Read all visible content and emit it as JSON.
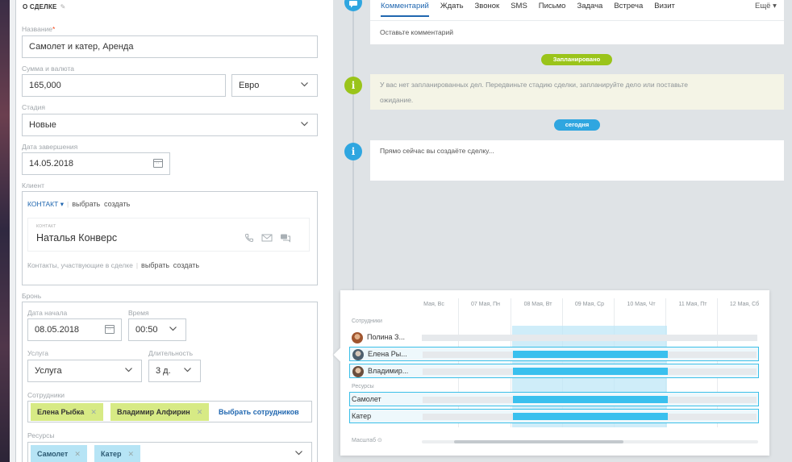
{
  "form": {
    "section_title": "О СДЕЛКЕ",
    "title_label": "Название",
    "title_value": "Самолет и катер, Аренда",
    "amount_label": "Сумма и валюта",
    "amount_value": "165,000",
    "currency_value": "Евро",
    "stage_label": "Стадия",
    "stage_value": "Новые",
    "close_date_label": "Дата завершения",
    "close_date_value": "14.05.2018",
    "client_label": "Клиент",
    "contact_dropdown": "КОНТАКТ",
    "choose": "выбрать",
    "create": "создать",
    "contact_tiny": "КОНТАКТ",
    "contact_name": "Наталья Конверс",
    "participants_label": "Контакты, участвующие в сделке",
    "booking_label": "Бронь",
    "start_date_label": "Дата начала",
    "start_date_value": "08.05.2018",
    "time_label": "Время",
    "time_value": "00:50",
    "service_label": "Услуга",
    "service_value": "Услуга",
    "duration_label": "Длительность",
    "duration_value": "3 д.",
    "employees_label": "Сотрудники",
    "employees": [
      "Елена Рыбка",
      "Владимир Алфирин"
    ],
    "select_employees": "Выбрать сотрудников",
    "resources_label": "Ресурсы",
    "resources": [
      "Самолет",
      "Катер"
    ]
  },
  "timeline": {
    "tabs": [
      "Комментарий",
      "Ждать",
      "Звонок",
      "SMS",
      "Письмо",
      "Задача",
      "Встреча",
      "Визит"
    ],
    "more": "Ещё",
    "comment_placeholder": "Оставьте комментарий",
    "planned_pill": "Запланировано",
    "planned_note_1": "У вас нет запланированных дел. Передвиньте стадию сделки, запланируйте дело или поставьте",
    "planned_note_2": "ожидание.",
    "today_pill": "сегодня",
    "creating_note": "Прямо сейчас вы создаёте сделку..."
  },
  "planner": {
    "days": [
      "Мая, Вс",
      "07 Мая, Пн",
      "08 Мая, Вт",
      "09 Мая, Ср",
      "10 Мая, Чт",
      "11 Мая, Пт",
      "12 Мая, Сб"
    ],
    "employees_group": "Сотрудники",
    "employees": [
      "Полина З...",
      "Елена Ры...",
      "Владимир..."
    ],
    "resources_group": "Ресурсы",
    "resources": [
      "Самолет",
      "Катер"
    ],
    "scale_label": "Масштаб"
  },
  "colors": {
    "accent_blue": "#2067b0",
    "timeline_green": "#9ac41a",
    "timeline_blue": "#2fa6e0",
    "booking_bar": "#39c0ee",
    "employee_tag": "#d7ea85",
    "resource_tag": "#b6e4f5"
  }
}
